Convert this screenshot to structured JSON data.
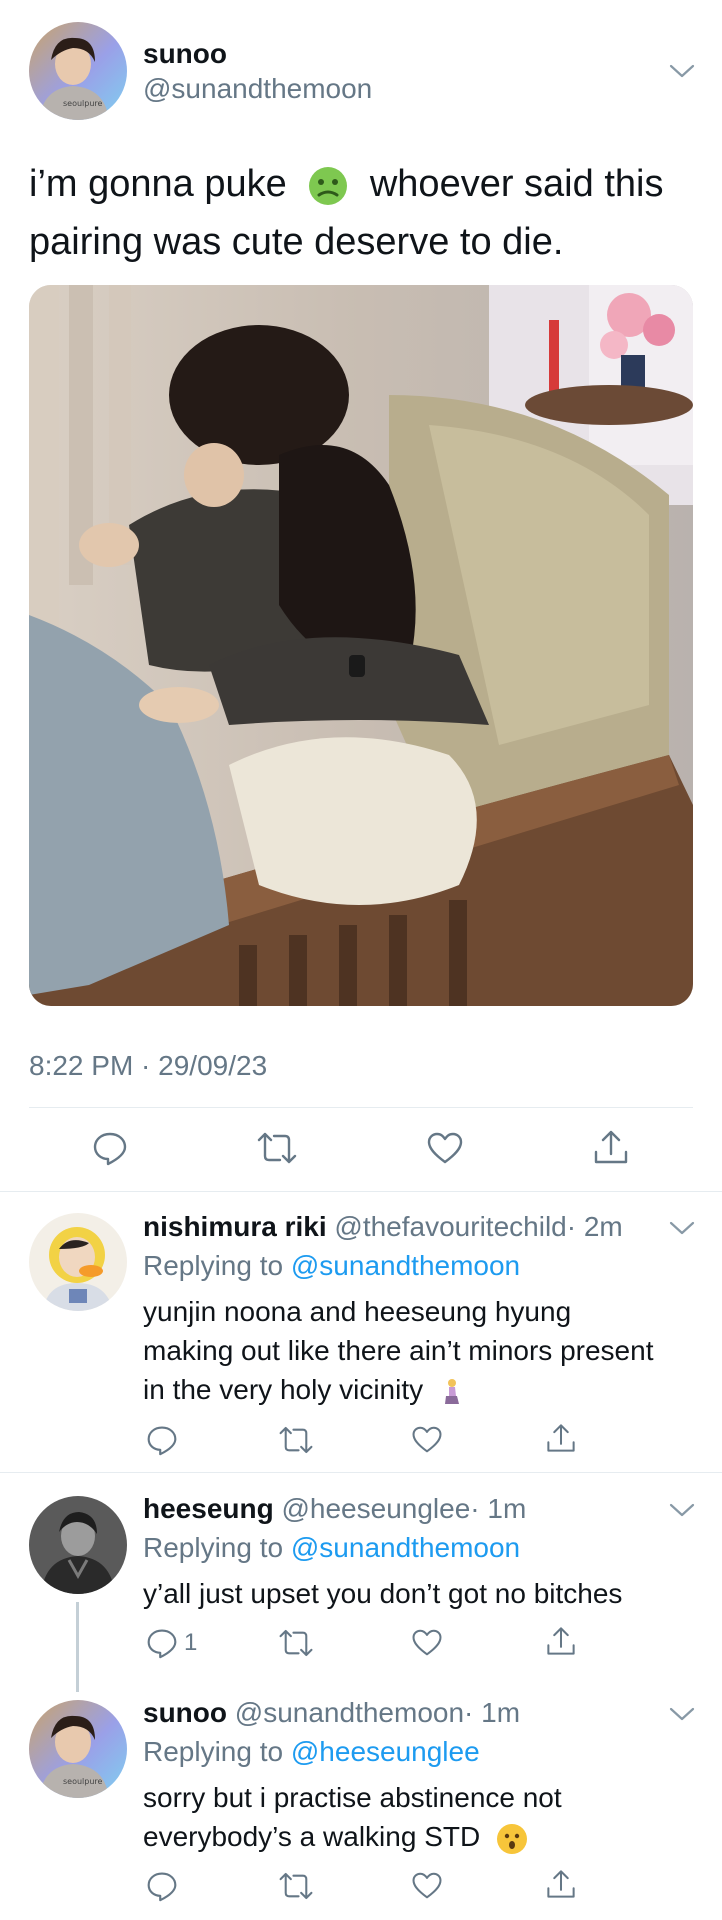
{
  "main_tweet": {
    "name": "sunoo",
    "handle": "@sunandthemoon",
    "text_part1": "i’m gonna puke",
    "text_part2": "whoever said this",
    "text_line2": "pairing was cute deserve to die.",
    "timestamp": "8:22 PM · 29/09/23"
  },
  "replies": [
    {
      "name": "nishimura riki",
      "handle": "@thefavouritechild",
      "time": "· 2m",
      "replying_prefix": "Replying to",
      "replying_to": "@sunandthemoon",
      "lines": [
        "yunjin noona and heeseung hyung",
        "making out like there ain’t minors present",
        "in the very holy vicinity"
      ],
      "reply_count": ""
    },
    {
      "name": "heeseung",
      "handle": "@heeseunglee",
      "time": "· 1m",
      "replying_prefix": "Replying to",
      "replying_to": "@sunandthemoon",
      "lines": [
        "y’all just upset you don’t got no bitches"
      ],
      "reply_count": "1"
    },
    {
      "name": "sunoo",
      "handle": "@sunandthemoon",
      "time": "· 1m",
      "replying_prefix": "Replying to",
      "replying_to": "@heeseunglee",
      "lines": [
        "sorry but i practise abstinence not",
        "everybody’s a walking STD"
      ],
      "reply_count": ""
    }
  ],
  "icons": [
    "reply-icon",
    "retweet-icon",
    "like-icon",
    "share-icon",
    "chevron-down-icon",
    "nauseated-face-emoji",
    "kneeling-woman-emoji",
    "hushed-face-emoji"
  ],
  "colors": {
    "link": "#1d9bf0",
    "secondary": "#657786",
    "divider": "#e6ecf0"
  }
}
